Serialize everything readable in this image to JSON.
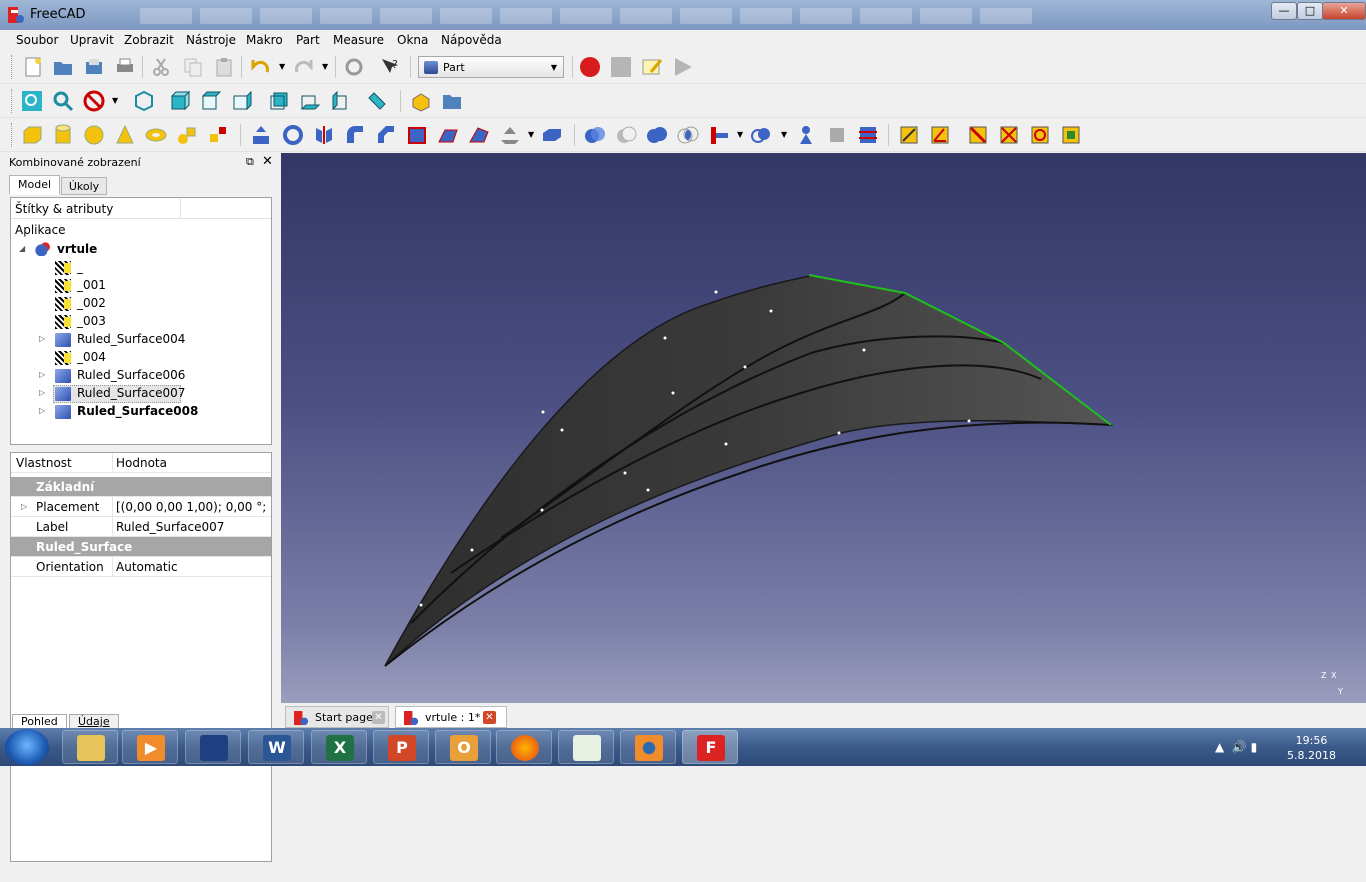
{
  "window": {
    "title": "FreeCAD"
  },
  "menu": [
    "Soubor",
    "Upravit",
    "Zobrazit",
    "Nástroje",
    "Makro",
    "Part",
    "Measure",
    "Okna",
    "Nápověda"
  ],
  "workbench": {
    "selected": "Part"
  },
  "combo": {
    "title": "Kombinované zobrazení",
    "tabs": [
      "Model",
      "Úkoly"
    ],
    "tree_header": "Štítky & atributy",
    "tree_root": "Aplikace",
    "items": [
      {
        "label": "vrtule",
        "icon": "document-icon"
      },
      {
        "label": "_",
        "icon": "sketch-icon"
      },
      {
        "label": "_001",
        "icon": "sketch-icon"
      },
      {
        "label": "_002",
        "icon": "sketch-icon"
      },
      {
        "label": "_003",
        "icon": "sketch-icon"
      },
      {
        "label": "Ruled_Surface004",
        "icon": "ruled-surface-icon"
      },
      {
        "label": "_004",
        "icon": "sketch-icon"
      },
      {
        "label": "Ruled_Surface006",
        "icon": "ruled-surface-icon"
      },
      {
        "label": "Ruled_Surface007",
        "icon": "ruled-surface-icon"
      },
      {
        "label": "Ruled_Surface008",
        "icon": "ruled-surface-icon"
      }
    ],
    "props_headers": [
      "Vlastnost",
      "Hodnota"
    ],
    "props": [
      {
        "group": "Základní"
      },
      {
        "key": "Placement",
        "value": "[(0,00 0,00 1,00); 0,00 °; (0,..."
      },
      {
        "key": "Label",
        "value": "Ruled_Surface007"
      },
      {
        "group": "Ruled_Surface"
      },
      {
        "key": "Orientation",
        "value": "Automatic"
      }
    ],
    "bottom_tabs": [
      "Pohled",
      "Údaje"
    ]
  },
  "doc_tabs": [
    "Start page",
    "vrtule : 1*"
  ],
  "axis": {
    "z": "Z",
    "x": "X",
    "y": "Y"
  },
  "clock": {
    "time": "19:56",
    "date": "5.8.2018"
  },
  "colors": {
    "accent": "#00c000",
    "surface": "#4a4a4a"
  }
}
